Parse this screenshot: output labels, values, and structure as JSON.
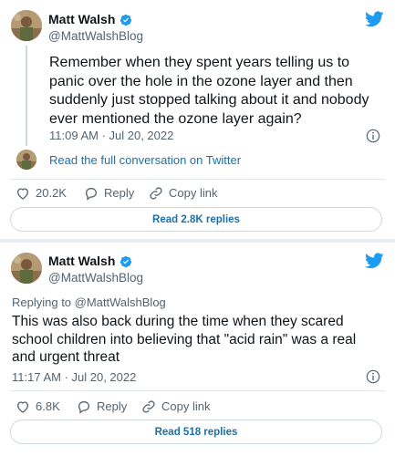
{
  "tweet1": {
    "author_name": "Matt Walsh",
    "author_handle": "@MattWalshBlog",
    "text_lines": [
      "Remember when they spent years telling us to",
      "panic over the hole in the ozone layer and then",
      "suddenly just stopped talking about it and nobody",
      "ever mentioned the ozone layer again?"
    ],
    "timestamp": "11:09 AM · Jul 20, 2022",
    "conversation_link": "Read the full conversation on Twitter",
    "likes": "20.2K",
    "reply_label": "Reply",
    "copy_link_label": "Copy link",
    "read_replies": "Read 2.8K replies"
  },
  "tweet2": {
    "author_name": "Matt Walsh",
    "author_handle": "@MattWalshBlog",
    "replying_to": "Replying to @MattWalshBlog",
    "text_lines": [
      "This was also back during the time when they scared",
      "school children into believing that \"acid rain\" was a real",
      "and urgent threat"
    ],
    "timestamp": "11:17 AM · Jul 20, 2022",
    "likes": "6.8K",
    "reply_label": "Reply",
    "copy_link_label": "Copy link",
    "read_replies": "Read 518 replies"
  },
  "colors": {
    "brand_blue": "#1d9bf0",
    "link_blue": "#1d6fa8",
    "like_red": "#c0242b",
    "muted_text": "#536471"
  },
  "icons": [
    "verified-badge-icon",
    "twitter-bird-icon",
    "info-icon",
    "heart-icon",
    "reply-bubble-icon",
    "link-chain-icon"
  ]
}
